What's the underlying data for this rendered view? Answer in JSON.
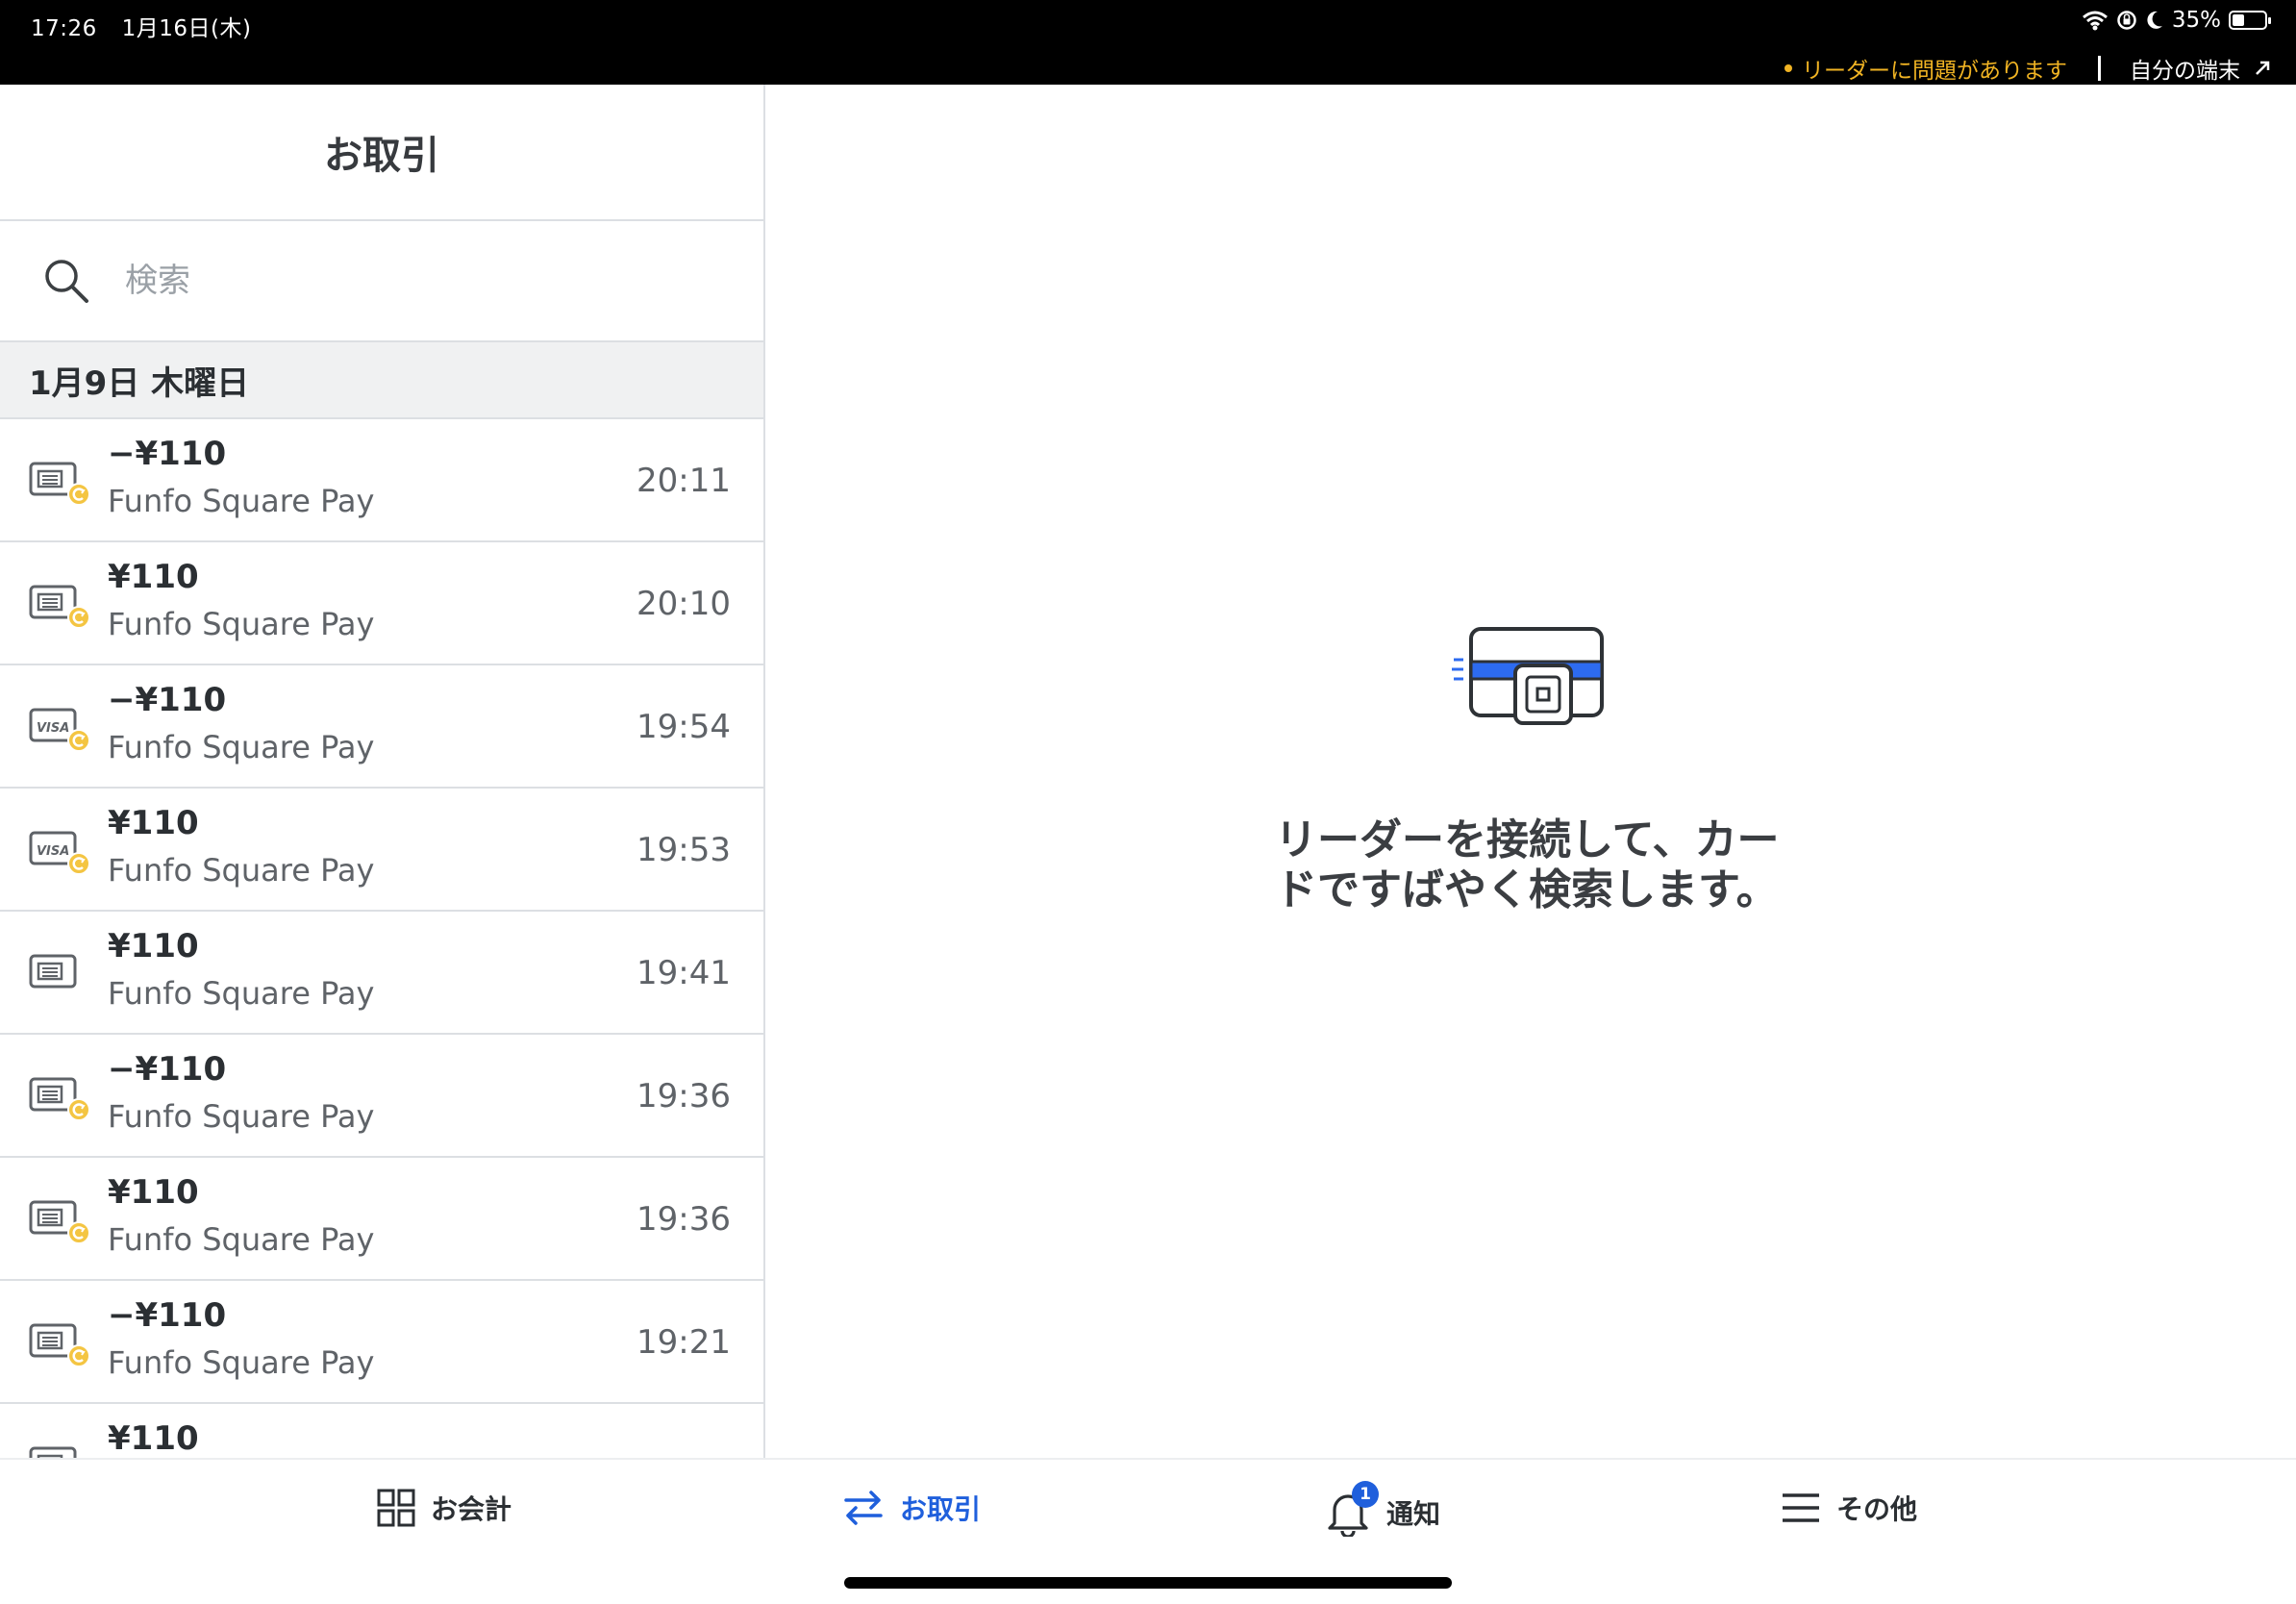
{
  "status_bar": {
    "time": "17:26",
    "date": "1月16日(木)",
    "battery": "35%",
    "reader_warning": "リーダーに問題があります",
    "my_device": "自分の端末"
  },
  "transactions_pane": {
    "title": "お取引",
    "search_placeholder": "検索",
    "date_header": "1月9日 木曜日",
    "items": [
      {
        "amount": "−¥110",
        "merchant": "Funfo Square Pay",
        "time": "20:11",
        "card": "generic"
      },
      {
        "amount": "¥110",
        "merchant": "Funfo Square Pay",
        "time": "20:10",
        "card": "generic"
      },
      {
        "amount": "−¥110",
        "merchant": "Funfo Square Pay",
        "time": "19:54",
        "card": "VISA"
      },
      {
        "amount": "¥110",
        "merchant": "Funfo Square Pay",
        "time": "19:53",
        "card": "VISA"
      },
      {
        "amount": "¥110",
        "merchant": "Funfo Square Pay",
        "time": "19:41",
        "card": "generic-plain"
      },
      {
        "amount": "−¥110",
        "merchant": "Funfo Square Pay",
        "time": "19:36",
        "card": "generic"
      },
      {
        "amount": "¥110",
        "merchant": "Funfo Square Pay",
        "time": "19:36",
        "card": "generic"
      },
      {
        "amount": "−¥110",
        "merchant": "Funfo Square Pay",
        "time": "19:21",
        "card": "generic"
      },
      {
        "amount": "¥110",
        "merchant": "",
        "time": "",
        "card": "generic"
      }
    ]
  },
  "detail_pane": {
    "message": "リーダーを接続して、カードですばやく検索します。"
  },
  "tab_bar": {
    "checkout": "お会計",
    "transactions": "お取引",
    "notifications": "通知",
    "notifications_badge": "1",
    "more": "その他"
  },
  "colors": {
    "accent": "#1f5fdc",
    "warning": "#f0b323"
  }
}
